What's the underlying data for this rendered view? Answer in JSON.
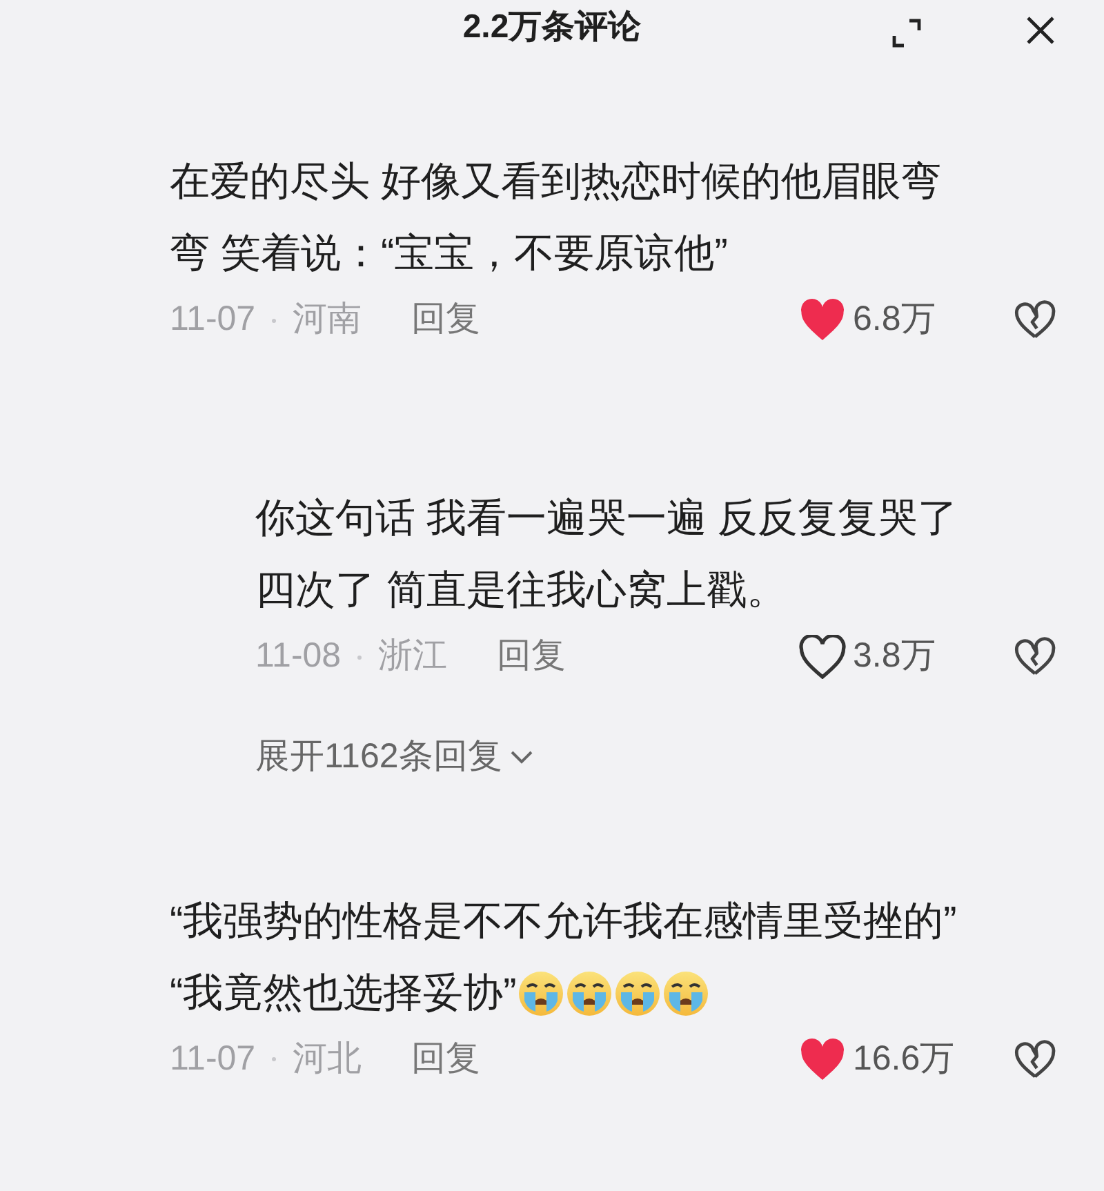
{
  "header": {
    "title": "2.2万条评论"
  },
  "comments": [
    {
      "lines": [
        "在爱的尽头 好像又看到热恋时候的他眉眼弯",
        "弯 笑着说：“宝宝，不要原谅他”"
      ],
      "date": "11-07",
      "location": "河南",
      "reply": "回复",
      "liked": true,
      "likes": "6.8万",
      "replies": [
        {
          "lines": [
            "你这句话 我看一遍哭一遍 反反复复哭了",
            "四次了 简直是往我心窝上戳。"
          ],
          "date": "11-08",
          "location": "浙江",
          "reply": "回复",
          "liked": false,
          "likes": "3.8万"
        }
      ],
      "expand": "展开1162条回复"
    },
    {
      "lines": [
        "“我强势的性格是不不允许我在感情里受挫的”",
        "“我竟然也选择妥协”"
      ],
      "emojis": [
        {
          "kind": "crying"
        },
        {
          "kind": "crying"
        },
        {
          "kind": "crying"
        },
        {
          "kind": "crying"
        }
      ],
      "date": "11-07",
      "location": "河北",
      "reply": "回复",
      "liked": true,
      "likes": "16.6万"
    }
  ]
}
